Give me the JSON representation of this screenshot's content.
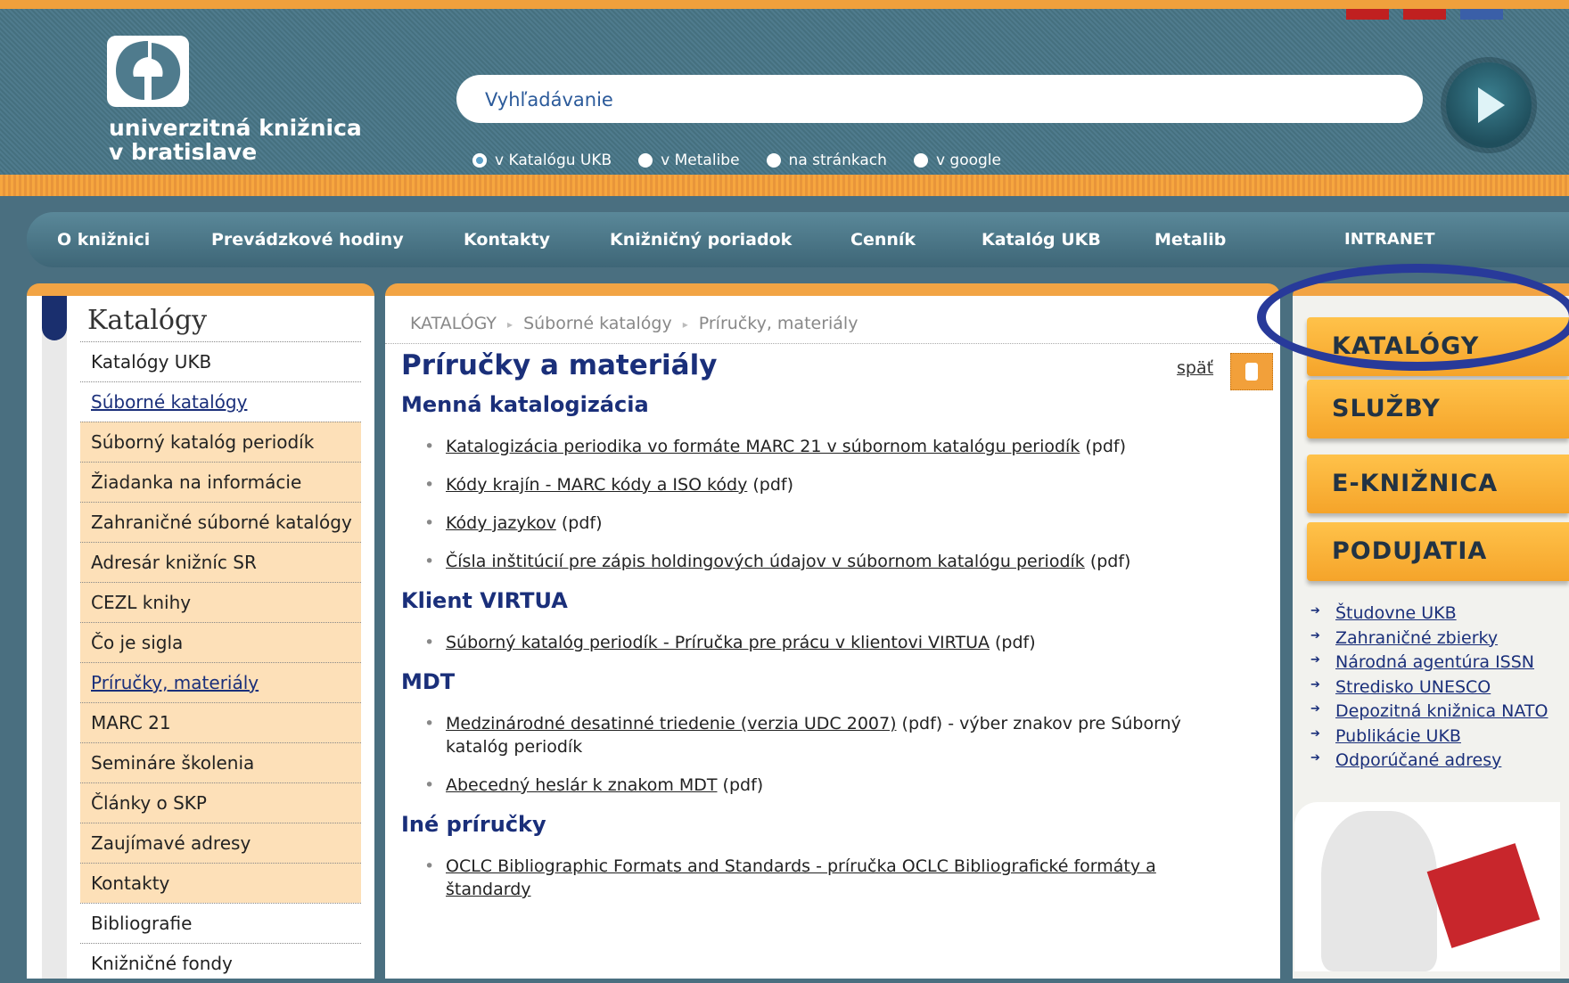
{
  "header": {
    "logo_line1": "univerzitná knižnica",
    "logo_line2": "v bratislave",
    "search_value": "Vyhľadávanie",
    "radio_options": [
      "v Katalógu UKB",
      "v Metalibe",
      "na stránkach",
      "v google"
    ],
    "selected_radio": "v Katalógu UKB"
  },
  "nav": [
    "O knižnici",
    "Prevádzkové hodiny",
    "Kontakty",
    "Knižničný poriadok",
    "Cenník",
    "Katalóg UKB",
    "Metalib",
    "INTRANET"
  ],
  "sidebar": {
    "title": "Katalógy",
    "items": [
      "Katalógy UKB",
      "Súborné katalógy",
      "Súborný katalóg periodík",
      "Žiadanka na informácie",
      "Zahraničné súborné katalógy",
      "Adresár knižníc SR",
      "CEZL knihy",
      "Čo je sigla",
      "Príručky, materiály",
      "MARC 21",
      "Semináre školenia",
      "Články o SKP",
      "Zaujímavé adresy",
      "Kontakty",
      "Bibliografie",
      "Knižničné fondy"
    ]
  },
  "breadcrumb": [
    "KATALÓGY",
    "Súborné katalógy",
    "Príručky, materiály"
  ],
  "main": {
    "title": "Príručky a materiály",
    "back_label": "späť",
    "sections": [
      {
        "heading": "Menná katalogizácia",
        "items": [
          {
            "link": "Katalogizácia periodika vo formáte MARC 21 v súbornom katalógu periodík",
            "suffix": " (pdf)"
          },
          {
            "link": "Kódy krajín - MARC kódy a ISO kódy",
            "suffix": " (pdf)"
          },
          {
            "link": "Kódy jazykov",
            "suffix": "  (pdf)"
          },
          {
            "link": "Čísla inštitúcií pre zápis holdingových údajov v súbornom katalógu periodík",
            "suffix": " (pdf)"
          }
        ]
      },
      {
        "heading": "Klient VIRTUA",
        "items": [
          {
            "link": "Súborný katalóg periodík - Príručka pre prácu v klientovi VIRTUA",
            "suffix": " (pdf)"
          }
        ]
      },
      {
        "heading": "MDT",
        "items": [
          {
            "link": "Medzinárodné desatinné triedenie (verzia UDC 2007)",
            "suffix": " (pdf) - výber znakov pre Súborný katalóg periodík"
          },
          {
            "link": "Abecedný heslár k znakom MDT",
            "suffix": " (pdf)"
          }
        ]
      },
      {
        "heading": "Iné príručky",
        "items": [
          {
            "link": "OCLC Bibliographic Formats and Standards - príručka OCLC Bibliografické formáty a štandardy",
            "suffix": ""
          }
        ]
      }
    ]
  },
  "right": {
    "categories": [
      "KATALÓGY",
      "SLUŽBY",
      "E-KNIŽNICA",
      "PODUJATIA"
    ],
    "links": [
      "Študovne UKB",
      "Zahraničné zbierky",
      "Národná agentúra ISSN",
      "Stredisko UNESCO",
      "Depozitná knižnica NATO",
      "Publikácie UKB",
      "Odporúčané adresy"
    ]
  }
}
